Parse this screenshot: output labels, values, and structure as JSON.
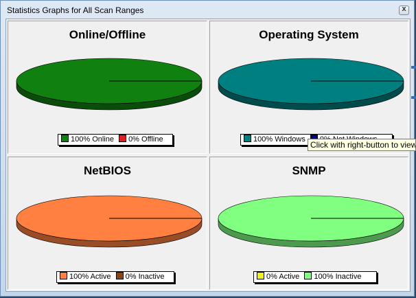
{
  "window": {
    "title": "Statistics Graphs for All Scan Ranges",
    "close_glyph": "x"
  },
  "tooltip": "Click with right-button to view",
  "colors": {
    "online": "#108010",
    "offline": "#e02020",
    "windows": "#007f80",
    "not_windows": "#000080",
    "netbios_active": "#ff8040",
    "netbios_inactive": "#8b4513",
    "snmp_active": "#f0f020",
    "snmp_inactive": "#80ff80"
  },
  "chart_data": [
    {
      "type": "pie",
      "title": "Online/Offline",
      "series": [
        {
          "name": "Online",
          "value": 100,
          "label": "100% Online",
          "color": "#108010"
        },
        {
          "name": "Offline",
          "value": 0,
          "label": "0% Offline",
          "color": "#e02020"
        }
      ]
    },
    {
      "type": "pie",
      "title": "Operating System",
      "series": [
        {
          "name": "Windows",
          "value": 100,
          "label": "100% Windows",
          "color": "#007f80"
        },
        {
          "name": "Not Windows",
          "value": 0,
          "label": "0% Not Windows",
          "color": "#000080"
        }
      ]
    },
    {
      "type": "pie",
      "title": "NetBIOS",
      "series": [
        {
          "name": "Active",
          "value": 100,
          "label": "100% Active",
          "color": "#ff8040"
        },
        {
          "name": "Inactive",
          "value": 0,
          "label": "0% Inactive",
          "color": "#8b4513"
        }
      ]
    },
    {
      "type": "pie",
      "title": "SNMP",
      "series": [
        {
          "name": "Active",
          "value": 0,
          "label": "0% Active",
          "color": "#f0f020"
        },
        {
          "name": "Inactive",
          "value": 100,
          "label": "100% Inactive",
          "color": "#80ff80"
        }
      ]
    }
  ]
}
